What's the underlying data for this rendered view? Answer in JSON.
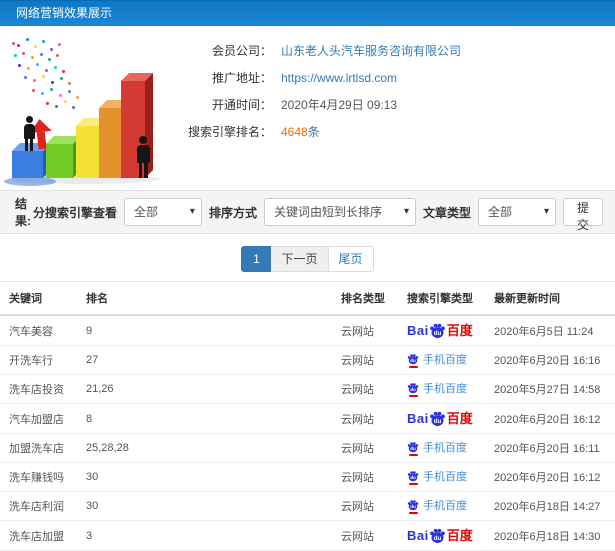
{
  "header": {
    "title": "网络营销效果展示"
  },
  "info": {
    "company_label": "会员公司：",
    "company_value": "山东老人头汽车服务咨询有限公司",
    "url_label": "推广地址：",
    "url_value": "https://www.lrtlsd.com",
    "open_time_label": "开通时间：",
    "open_time_value": "2020年4月29日 09:13",
    "rank_label": "搜索引擎排名：",
    "rank_value": "4648",
    "rank_unit": "条"
  },
  "filter": {
    "result_label": "结果:",
    "engine_filter_label": "分搜索引擎查看",
    "engine_filter_value": "全部",
    "sort_label": "排序方式",
    "sort_value": "关键词由短到长排序",
    "article_type_label": "文章类型",
    "article_type_value": "全部",
    "submit_label": "提交"
  },
  "pagination": {
    "current": "1",
    "next_label": "下一页",
    "last_label": "尾页"
  },
  "table": {
    "headers": [
      "关键词",
      "排名",
      "排名类型",
      "搜索引擎类型",
      "最新更新时间"
    ],
    "engine_display": {
      "baidu": {
        "prefix": "Bai",
        "paw_text": "du",
        "suffix": "百度"
      },
      "mobile_baidu": {
        "paw_text": "du",
        "label": "手机百度"
      }
    },
    "rows": [
      {
        "keyword": "汽车美容",
        "rank": "9",
        "rank_type": "云网站",
        "engine": "baidu",
        "updated": "2020年6月5日 11:24"
      },
      {
        "keyword": "开洗车行",
        "rank": "27",
        "rank_type": "云网站",
        "engine": "mobile_baidu",
        "updated": "2020年6月20日 16:16"
      },
      {
        "keyword": "洗车店投资",
        "rank": "21,26",
        "rank_type": "云网站",
        "engine": "mobile_baidu",
        "updated": "2020年5月27日 14:58"
      },
      {
        "keyword": "汽车加盟店",
        "rank": "8",
        "rank_type": "云网站",
        "engine": "baidu",
        "updated": "2020年6月20日 16:12"
      },
      {
        "keyword": "加盟洗车店",
        "rank": "25,28,28",
        "rank_type": "云网站",
        "engine": "mobile_baidu",
        "updated": "2020年6月20日 16:11"
      },
      {
        "keyword": "洗车赚钱吗",
        "rank": "30",
        "rank_type": "云网站",
        "engine": "mobile_baidu",
        "updated": "2020年6月20日 16:12"
      },
      {
        "keyword": "洗车店利润",
        "rank": "30",
        "rank_type": "云网站",
        "engine": "mobile_baidu",
        "updated": "2020年6月18日 14:27"
      },
      {
        "keyword": "洗车店加盟",
        "rank": "3",
        "rank_type": "云网站",
        "engine": "baidu",
        "updated": "2020年6月18日 14:30"
      }
    ]
  },
  "colors": {
    "header_bg": "#1687d2",
    "accent_blue": "#337ab7",
    "highlight_orange": "#ff6600",
    "baidu_blue": "#2932e1",
    "baidu_red": "#e10602",
    "mobile_baidu_text": "#3c8dde"
  }
}
